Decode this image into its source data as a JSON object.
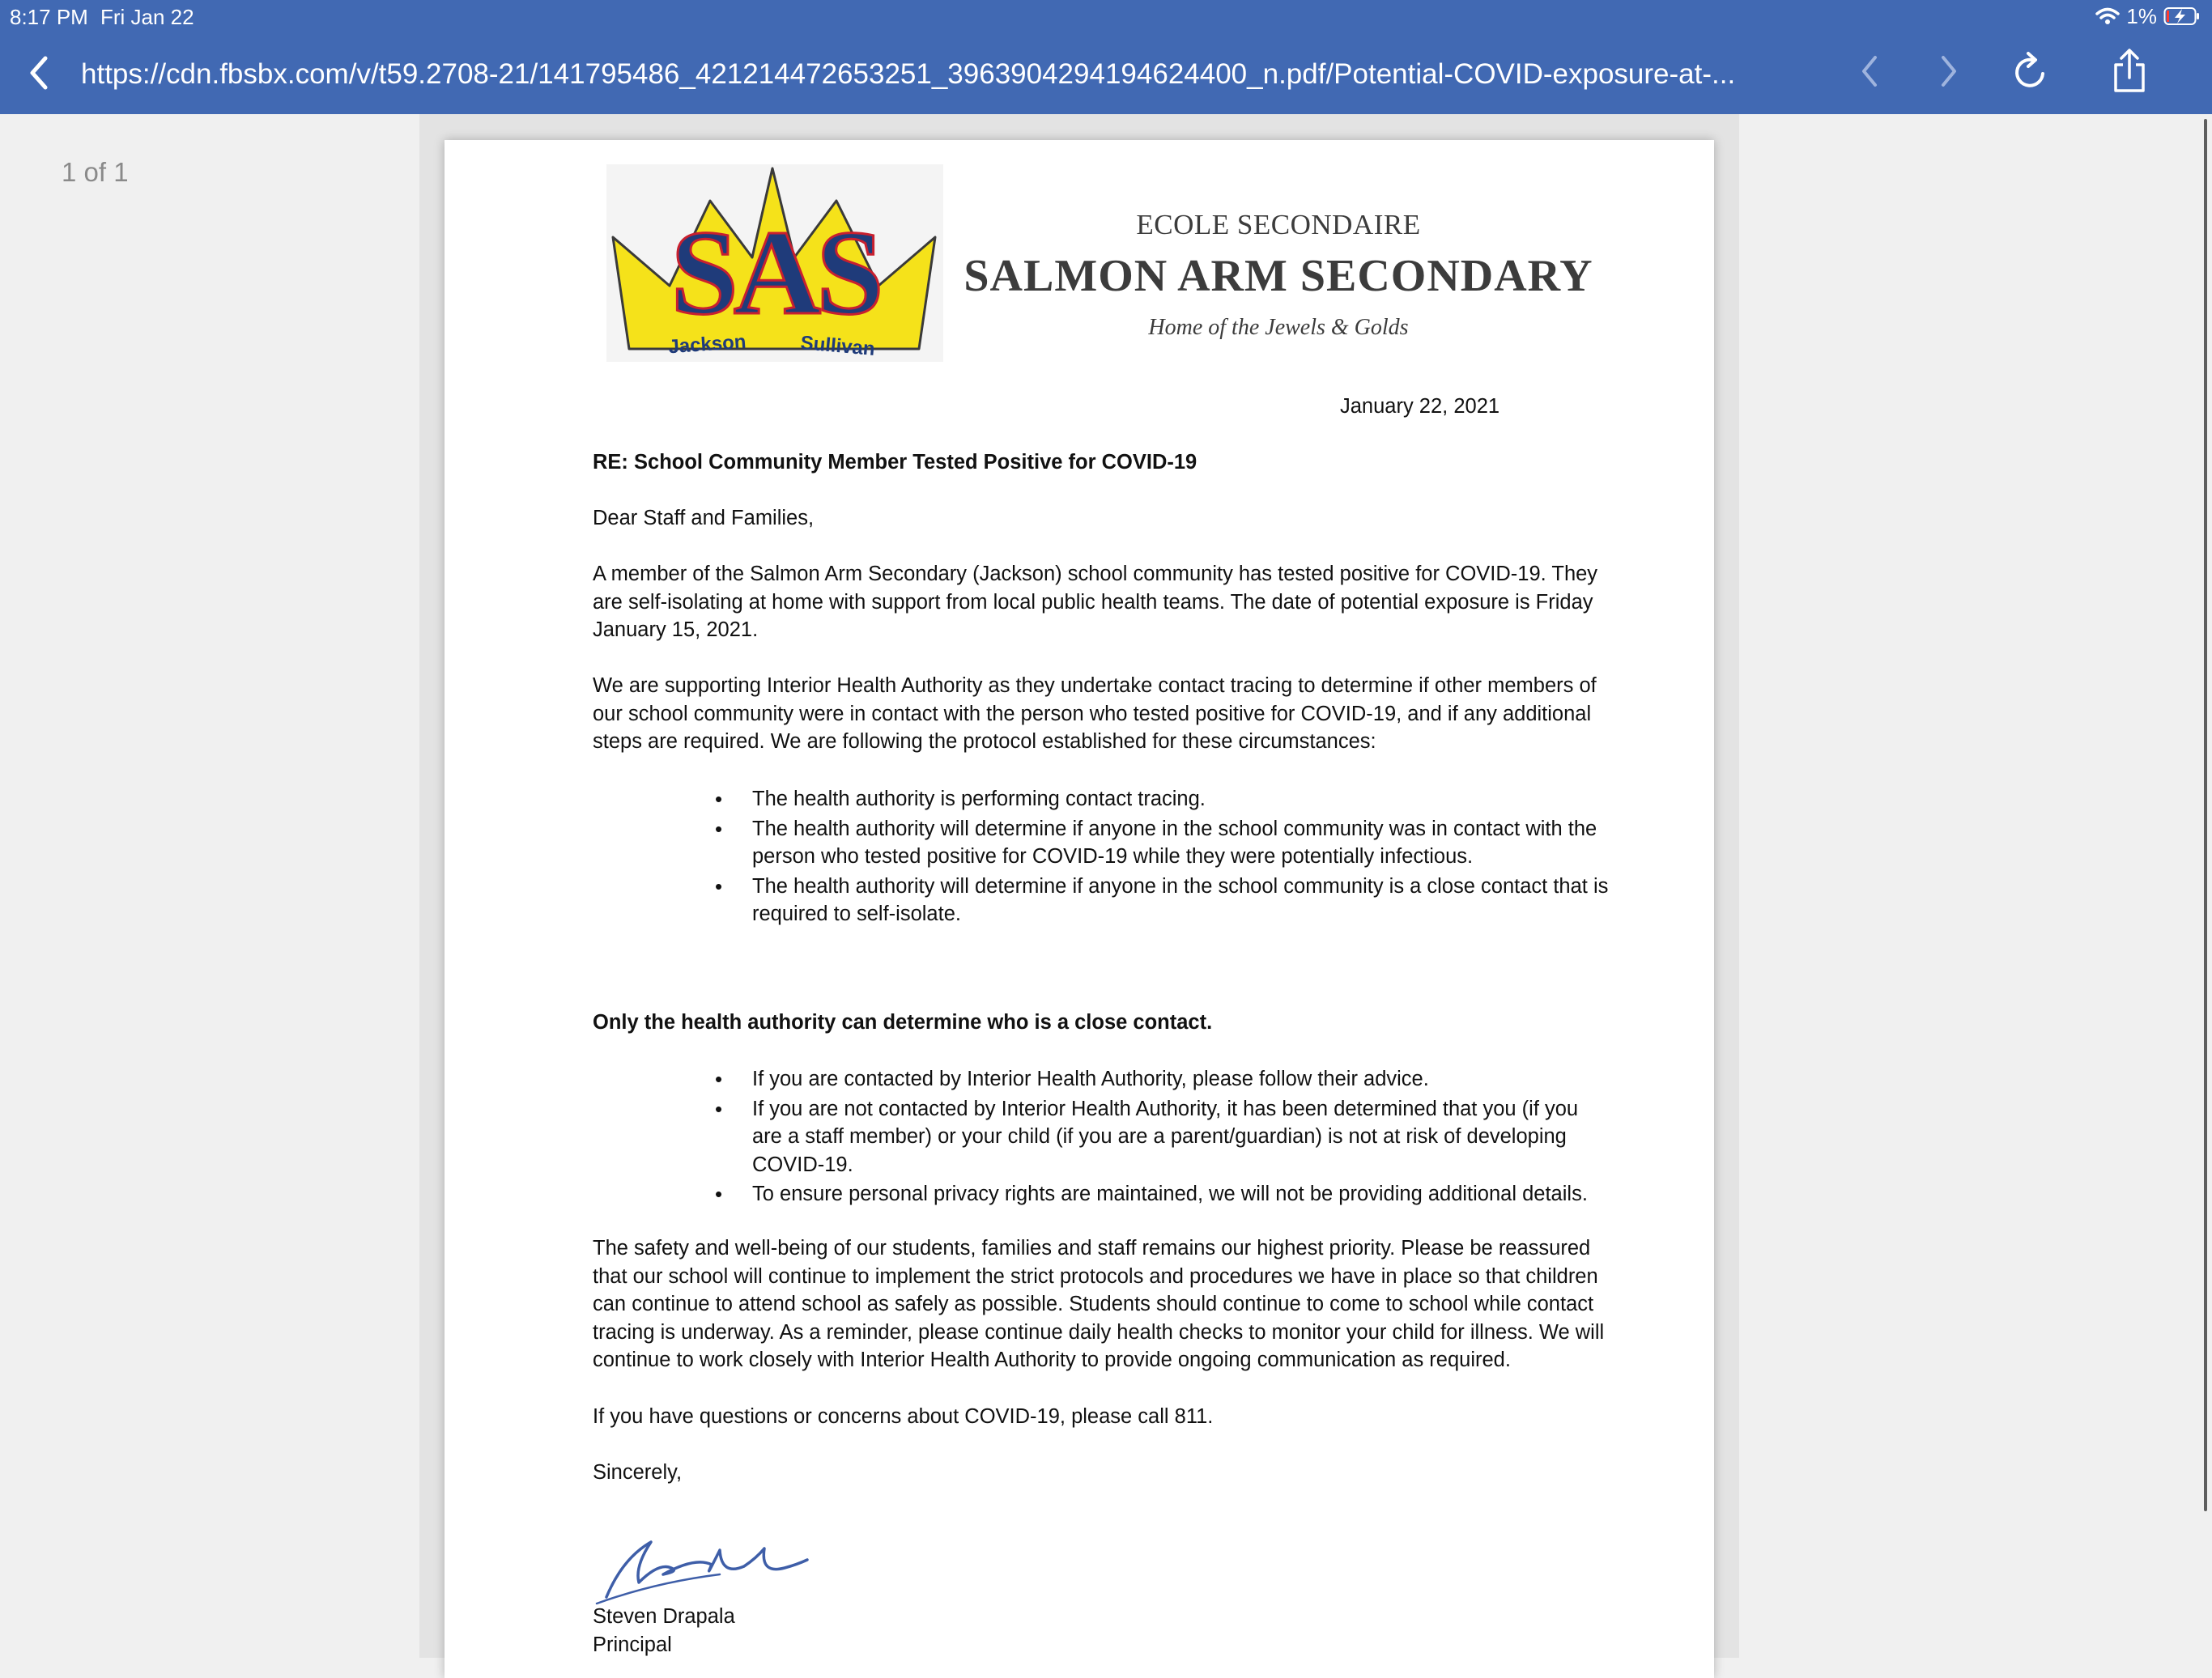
{
  "status_bar": {
    "time": "8:17 PM",
    "date": "Fri Jan 22",
    "battery": "1%"
  },
  "toolbar": {
    "url": "https://cdn.fbsbx.com/v/t59.2708-21/141795486_421214472653251_3963904294194624400_n.pdf/Potential-COVID-exposure-at-..."
  },
  "viewer": {
    "page_counter": "1 of 1"
  },
  "letterhead": {
    "logo_text": "SAS",
    "logo_left": "Jackson",
    "logo_right": "Sullivan",
    "subtitle": "ECOLE SECONDAIRE",
    "name": "SALMON ARM SECONDARY",
    "motto": "Home of the Jewels & Golds"
  },
  "letter": {
    "date": "January 22, 2021",
    "subject": "RE: School Community Member Tested Positive for COVID-19",
    "salutation": "Dear Staff and Families,",
    "para1": "A member of the Salmon Arm Secondary (Jackson) school community has tested positive for COVID-19. They are self-isolating at home with support from local public health teams. The date of potential exposure is Friday January 15, 2021.",
    "para2": "We are supporting Interior Health Authority as they undertake contact tracing to determine if other members of our school community were in contact with the person who tested positive for COVID-19, and if any additional steps are required. We are following the protocol established for these circumstances:",
    "bullets1": [
      "The health authority is performing contact tracing.",
      "The health authority will determine if anyone in the school community was in contact with the person who tested positive for COVID-19 while they were potentially infectious.",
      "The health authority will determine if anyone in the school community is a close contact that is required to self-isolate."
    ],
    "emphasis": "Only the health authority can determine who is a close contact.",
    "bullets2": [
      "If you are contacted by Interior Health Authority, please follow their advice.",
      "If you are not contacted by Interior Health Authority, it has been determined that you (if you are a staff member) or your child (if you are a parent/guardian) is not at risk of developing COVID-19.",
      "To ensure personal privacy rights are maintained, we will not be providing additional details."
    ],
    "para3": "The safety and well-being of our students, families and staff remains our highest priority. Please be reassured that our school will continue to implement the strict protocols and procedures we have in place so that children can continue to attend school as safely as possible. Students should continue to come to school while contact tracing is underway. As a reminder, please continue daily health checks to monitor your child for illness. We will continue to work closely with Interior Health Authority to provide ongoing communication as required.",
    "para4": "If you have questions or concerns about COVID-19, please call 811.",
    "closing": "Sincerely,",
    "signer_name": "Steven Drapala",
    "signer_title": "Principal"
  },
  "colors": {
    "toolbar": "#4169b3",
    "logo_blue": "#1f3b7a",
    "logo_yellow": "#f5e21a",
    "logo_red": "#c8202f"
  }
}
